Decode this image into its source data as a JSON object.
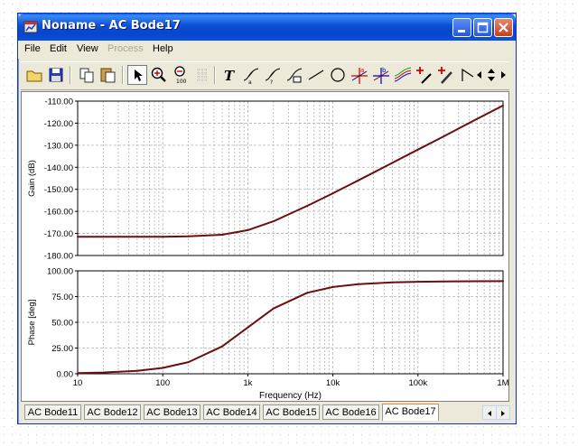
{
  "window": {
    "title": "Noname - AC Bode17"
  },
  "menu": [
    {
      "label": "File",
      "enabled": true
    },
    {
      "label": "Edit",
      "enabled": true
    },
    {
      "label": "View",
      "enabled": true
    },
    {
      "label": "Process",
      "enabled": false
    },
    {
      "label": "Help",
      "enabled": true
    }
  ],
  "toolbar_icons": [
    "open-icon",
    "save-icon",
    "copy-icon",
    "paste-icon",
    "pointer-icon",
    "zoom-in-icon",
    "zoom-100-icon",
    "grid-icon",
    "text-icon",
    "label-curve-a-icon",
    "label-curve-b-icon",
    "label-curve-c-icon",
    "line-icon",
    "circle-icon",
    "cursor-a-icon",
    "cursor-b-icon",
    "multi-curve-icon",
    "add-marker-icon",
    "pen-marker-icon",
    "tick-icon",
    "scroll-left-icon",
    "spin-updown-icon",
    "scroll-right-icon"
  ],
  "tabs": [
    "AC Bode11",
    "AC Bode12",
    "AC Bode13",
    "AC Bode14",
    "AC Bode15",
    "AC Bode16",
    "AC Bode17"
  ],
  "active_tab": "AC Bode17",
  "colors": {
    "trace": "#6b0f0f",
    "grid": "#b4b4b4",
    "titlebar": "#0a4fd4"
  },
  "chart_data": [
    {
      "type": "line",
      "ylabel": "Gain (dB)",
      "xscale": "log",
      "xlim": [
        10,
        1000000
      ],
      "ylim": [
        -180,
        -110
      ],
      "yticks": [
        "-110.00",
        "-120.00",
        "-130.00",
        "-140.00",
        "-150.00",
        "-160.00",
        "-170.00",
        "-180.00"
      ],
      "ytick_values": [
        -110,
        -120,
        -130,
        -140,
        -150,
        -160,
        -170,
        -180
      ],
      "x": [
        10,
        100,
        200,
        500,
        1000,
        2000,
        5000,
        10000,
        20000,
        50000,
        100000,
        200000,
        500000,
        1000000
      ],
      "y": [
        -171.5,
        -171.5,
        -171.3,
        -170.6,
        -168.5,
        -164.5,
        -157.5,
        -151.8,
        -145.9,
        -138.0,
        -132.0,
        -126.0,
        -118.0,
        -112.0
      ]
    },
    {
      "type": "line",
      "ylabel": "Phase [deg]",
      "xlabel": "Frequency (Hz)",
      "xscale": "log",
      "xlim": [
        10,
        1000000
      ],
      "ylim": [
        0,
        100
      ],
      "yticks": [
        "100.00",
        "75.00",
        "50.00",
        "25.00",
        "0.00"
      ],
      "ytick_values": [
        100,
        75,
        50,
        25,
        0
      ],
      "xticks": [
        "10",
        "100",
        "1k",
        "10k",
        "100k",
        "1M"
      ],
      "xtick_values": [
        10,
        100,
        1000,
        10000,
        100000,
        1000000
      ],
      "x": [
        10,
        20,
        50,
        100,
        200,
        500,
        1000,
        2000,
        5000,
        10000,
        20000,
        50000,
        100000,
        200000,
        500000,
        1000000
      ],
      "y": [
        0.6,
        1.2,
        2.9,
        5.7,
        11.3,
        26.6,
        45.0,
        63.4,
        78.7,
        84.3,
        87.1,
        88.9,
        89.4,
        89.7,
        89.9,
        90.0
      ]
    }
  ]
}
